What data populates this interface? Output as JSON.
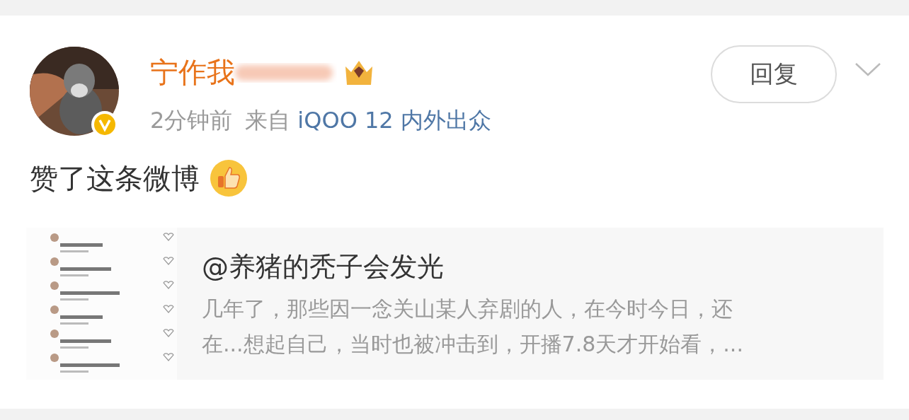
{
  "post": {
    "author": {
      "name": "宁作我",
      "verified": true
    },
    "time": "2分钟前",
    "source_label": "来自",
    "source": "iQOO 12 内外出众",
    "reply_button": "回复",
    "text": "赞了这条微博",
    "quote": {
      "author": "@养猪的秃子会发光",
      "summary_lines": [
        "几年了，那些因一念关山某人弃剧的人，在今时今日，还",
        "在...想起自己，当时也被冲击到，开播7.8天才开始看，..."
      ]
    }
  }
}
